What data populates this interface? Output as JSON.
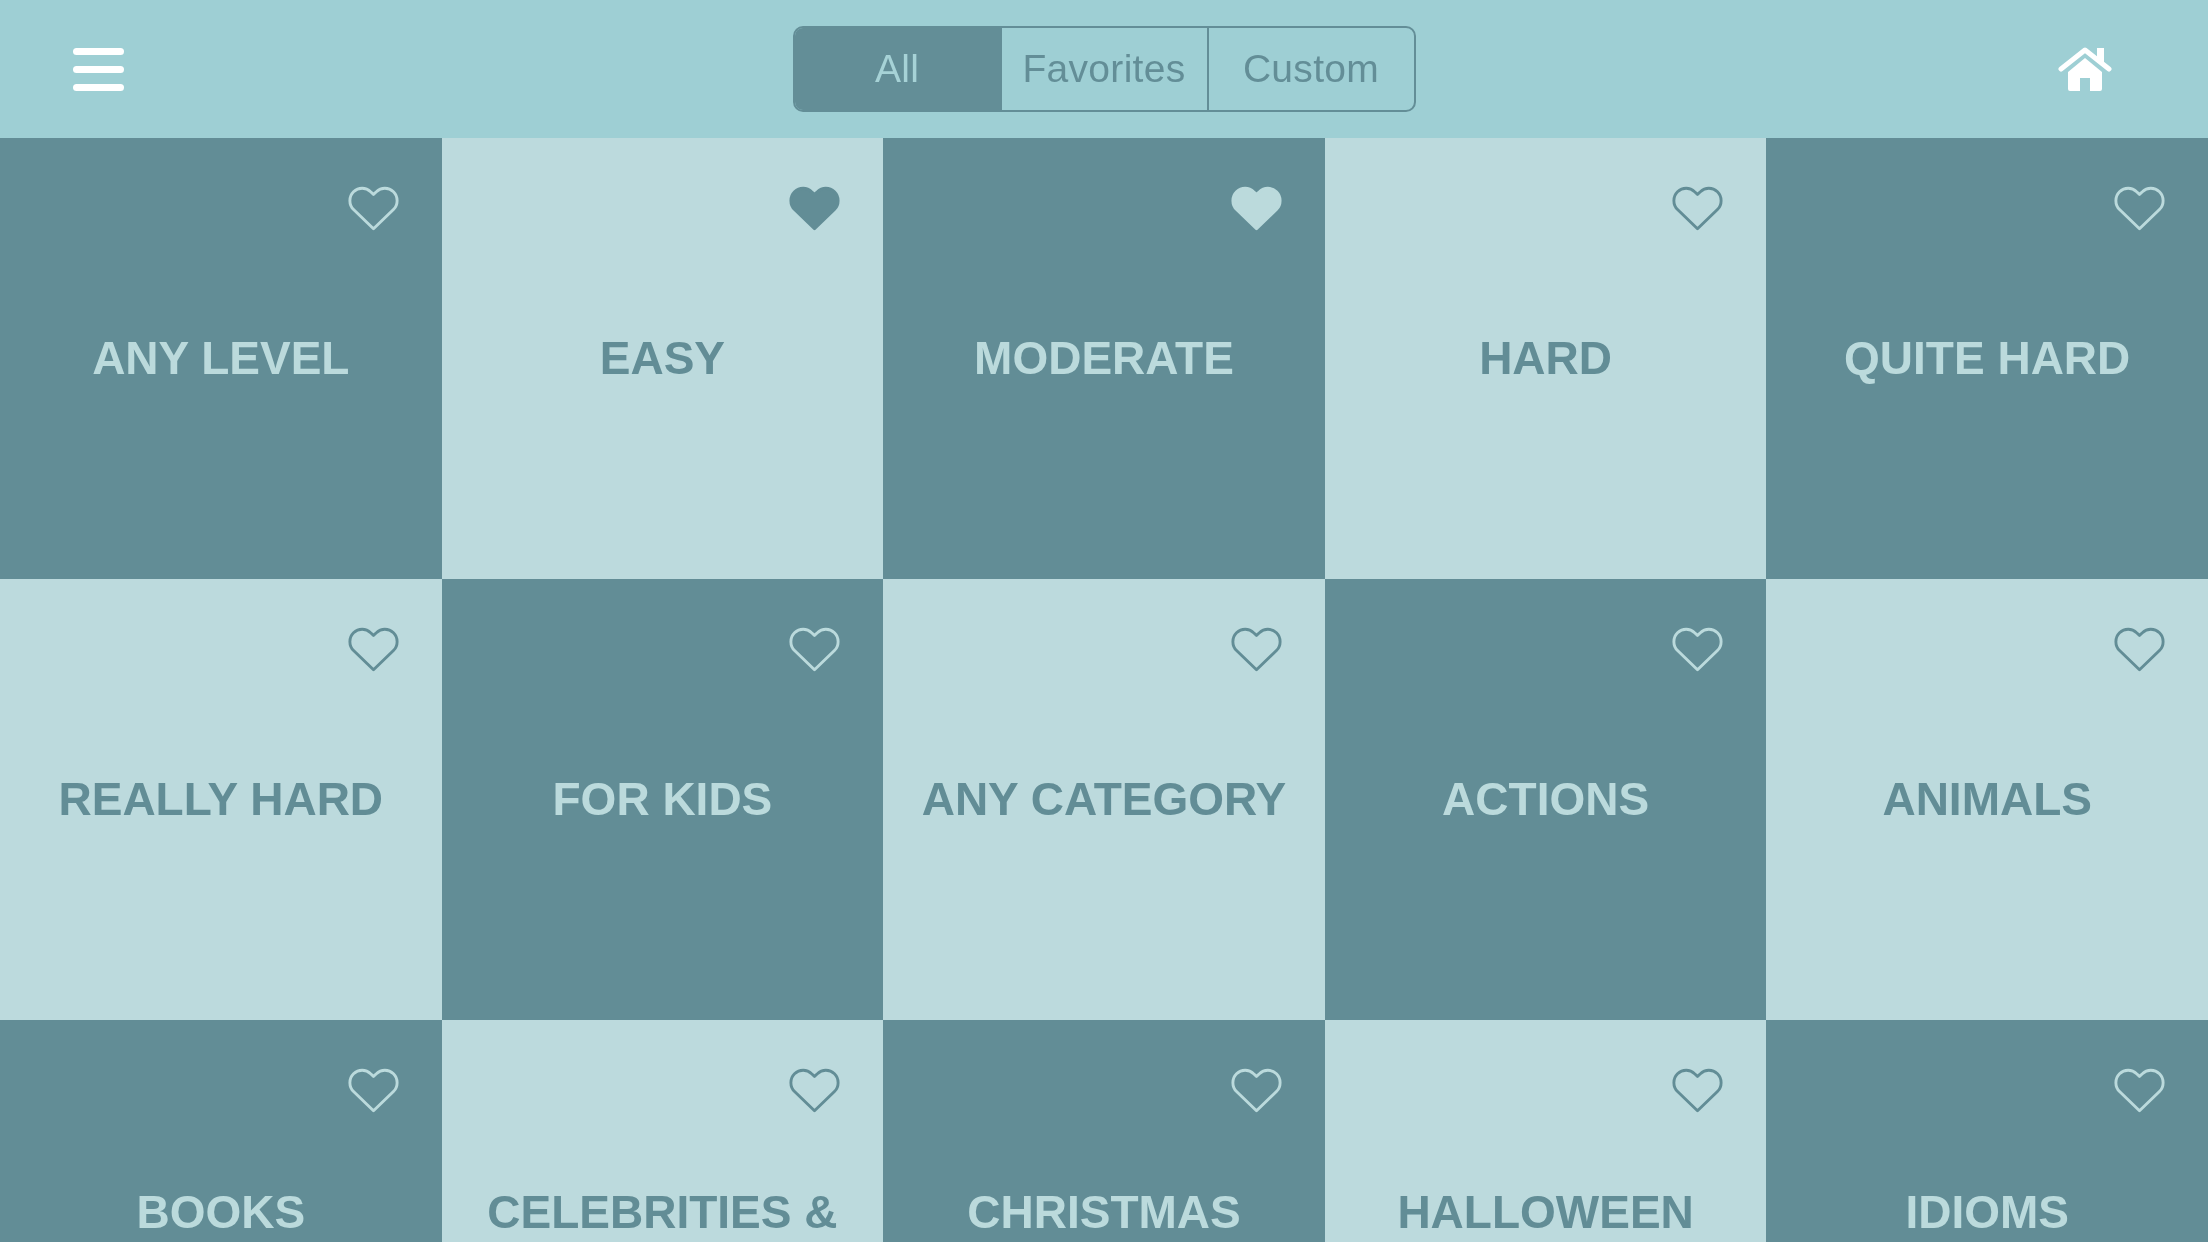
{
  "filter_tabs": [
    {
      "label": "All",
      "selected": true
    },
    {
      "label": "Favorites",
      "selected": false
    },
    {
      "label": "Custom",
      "selected": false
    }
  ],
  "tiles": [
    {
      "label": "ANY LEVEL",
      "favorite": false
    },
    {
      "label": "EASY",
      "favorite": true
    },
    {
      "label": "MODERATE",
      "favorite": true
    },
    {
      "label": "HARD",
      "favorite": false
    },
    {
      "label": "QUITE HARD",
      "favorite": false
    },
    {
      "label": "REALLY HARD",
      "favorite": false
    },
    {
      "label": "FOR KIDS",
      "favorite": false
    },
    {
      "label": "ANY CATEGORY",
      "favorite": false
    },
    {
      "label": "ACTIONS",
      "favorite": false
    },
    {
      "label": "ANIMALS",
      "favorite": false
    },
    {
      "label": "BOOKS",
      "favorite": false
    },
    {
      "label": "CELEBRITIES &",
      "favorite": false
    },
    {
      "label": "CHRISTMAS",
      "favorite": false
    },
    {
      "label": "HALLOWEEN",
      "favorite": false
    },
    {
      "label": "IDIOMS",
      "favorite": false
    }
  ]
}
